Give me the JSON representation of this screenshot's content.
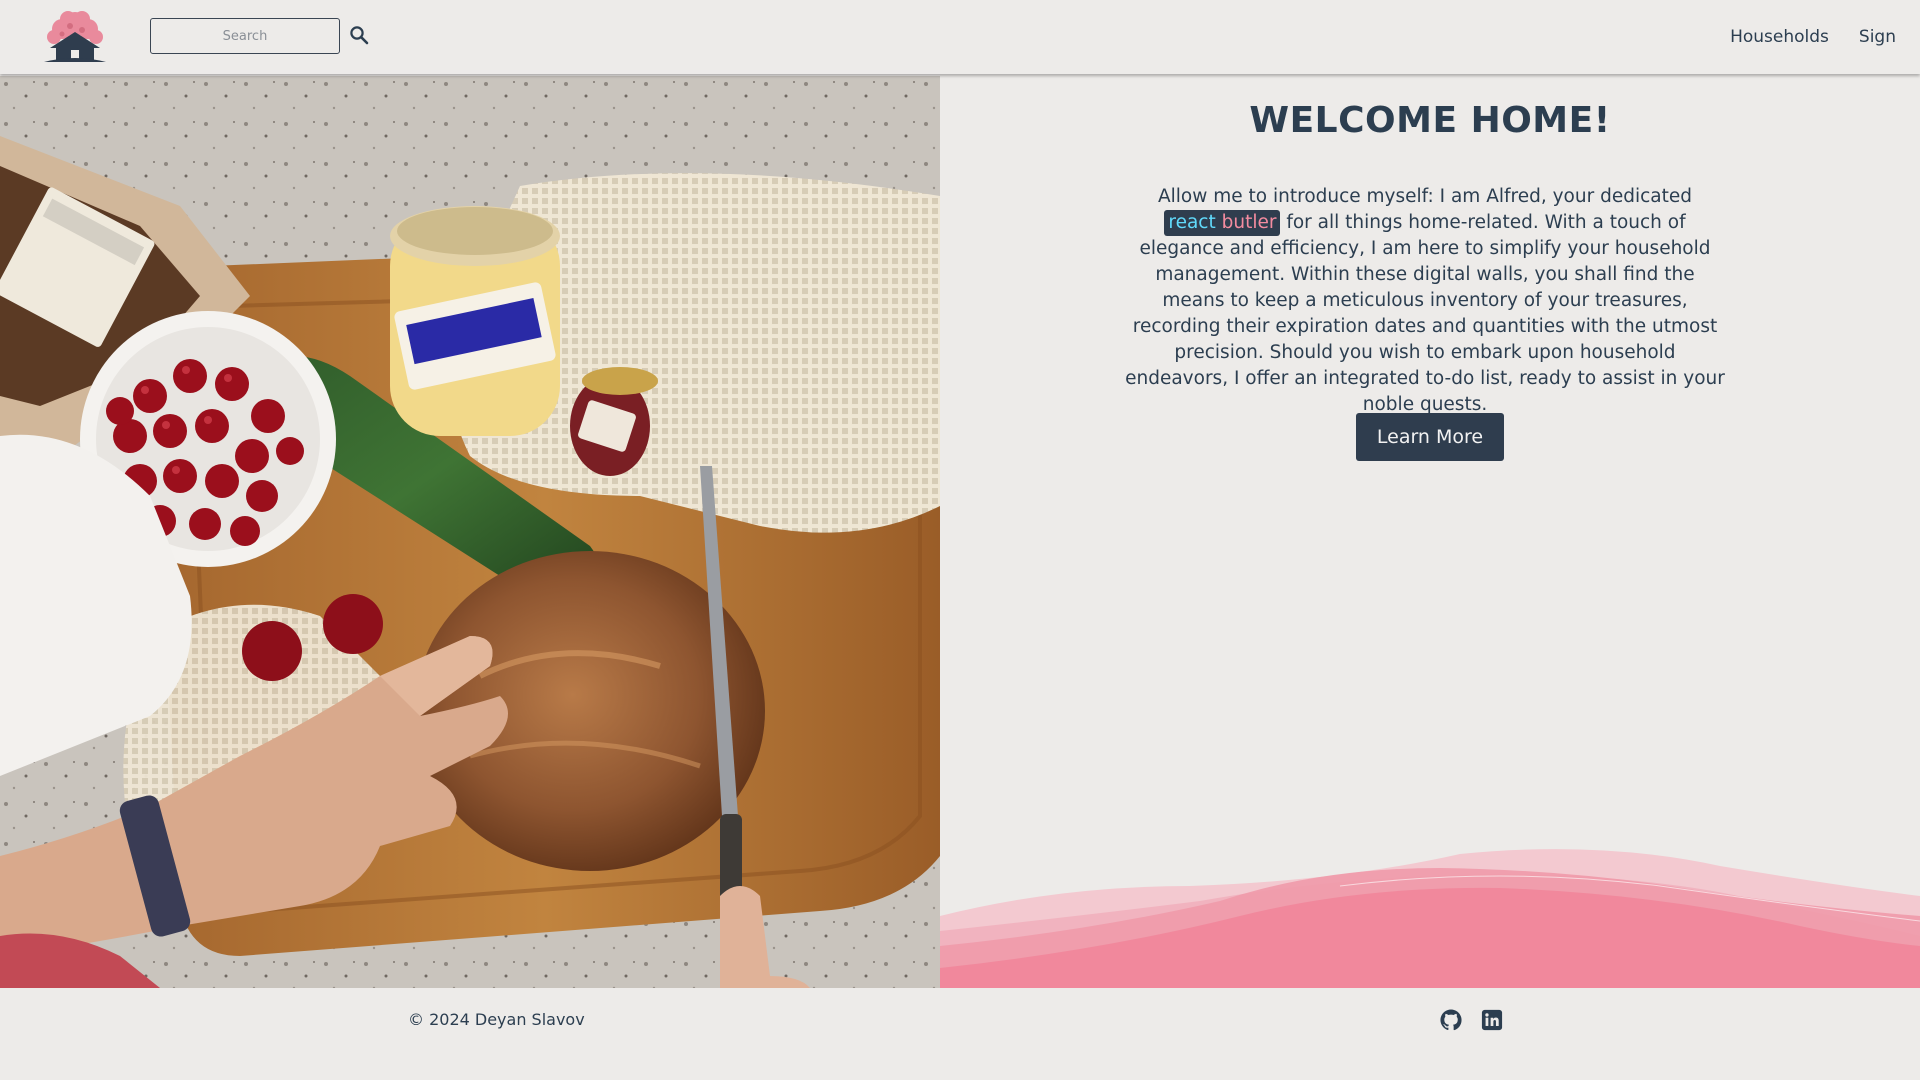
{
  "header": {
    "logo_alt": "Alfred home logo",
    "search": {
      "placeholder": "Search",
      "value": ""
    },
    "nav": [
      {
        "label": "Households"
      },
      {
        "label": "Sign"
      }
    ]
  },
  "hero": {
    "description": "Kitchen still-life photo"
  },
  "main": {
    "title": "WELCOME HOME!",
    "intro_before": "Allow me to introduce myself: I am Alfred, your dedicated ",
    "brand": {
      "word1": "react",
      "word2": "butler"
    },
    "intro_after": " for all things home-related. With a touch of elegance and efficiency, I am here to simplify your household management. Within these digital walls, you shall find the means to keep a meticulous inventory of your treasures, recording their expiration dates and quantities with the utmost precision. Should you wish to embark upon household endeavors, I offer an integrated to-do list, ready to assist in your noble quests.",
    "cta_label": "Learn More"
  },
  "footer": {
    "copyright": "© 2024 Deyan Slavov",
    "icons": [
      "github-icon",
      "linkedin-icon"
    ]
  },
  "colors": {
    "background": "#edebe9",
    "text": "#2c3e50",
    "button_bg": "#2f3d4e",
    "react_blue": "#61dafb",
    "butler_pink": "#f48ca0",
    "wave_pink": "#f1889c"
  }
}
